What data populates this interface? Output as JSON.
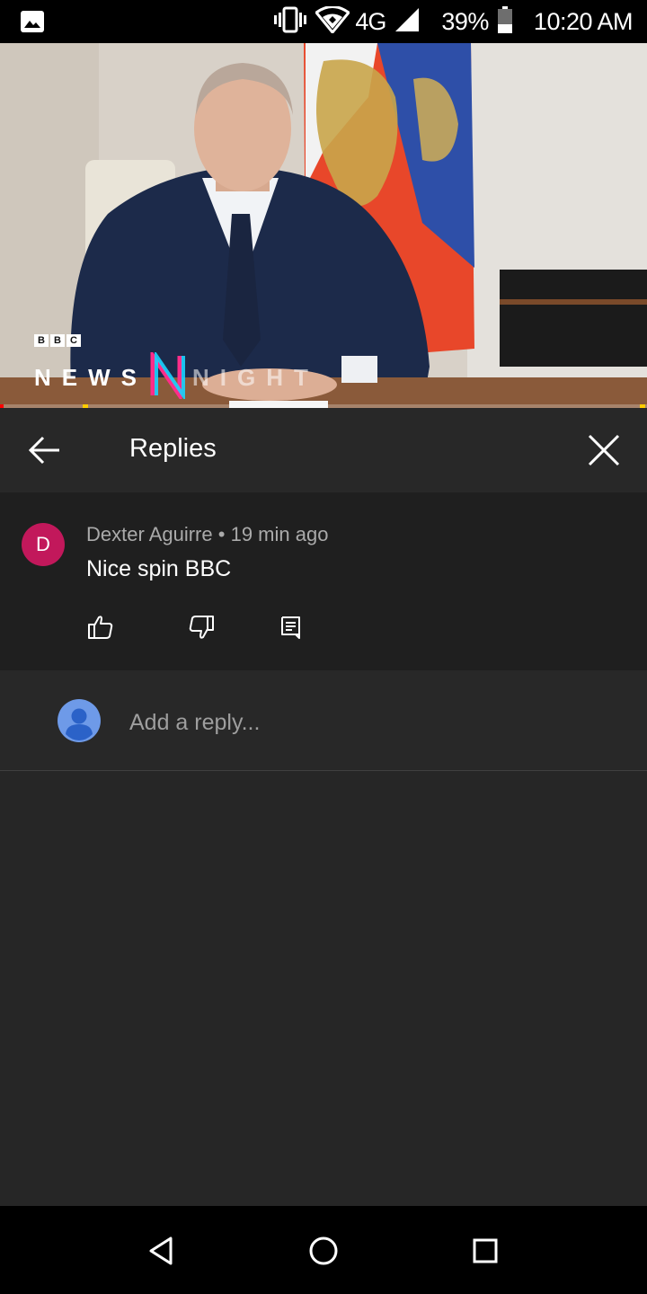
{
  "status_bar": {
    "network": "4G",
    "battery": "39%",
    "time": "10:20 AM",
    "icons": [
      "image-icon",
      "vibrate-icon",
      "wifi-icon",
      "signal-icon",
      "battery-icon"
    ]
  },
  "video": {
    "watermark": {
      "bbc": [
        "B",
        "B",
        "C"
      ],
      "news": "NEWS",
      "night": "NIGHT"
    },
    "progress": 0.005,
    "colors": {
      "progress": "#ff0000",
      "ad_marker": "#ffcc00"
    }
  },
  "replies_panel": {
    "title": "Replies",
    "back_icon": "arrow-left-icon",
    "close_icon": "close-icon"
  },
  "comment": {
    "avatar_letter": "D",
    "avatar_color": "#c2185b",
    "author": "Dexter Aguirre",
    "separator": "•",
    "time": "19 min ago",
    "text": "Nice spin BBC",
    "actions": [
      "thumbs-up-icon",
      "thumbs-down-icon",
      "comment-icon"
    ]
  },
  "reply_box": {
    "placeholder": "Add a reply...",
    "avatar_icon": "user-avatar-icon"
  },
  "nav_bar": {
    "buttons": [
      "nav-back-icon",
      "nav-home-icon",
      "nav-recents-icon"
    ]
  }
}
